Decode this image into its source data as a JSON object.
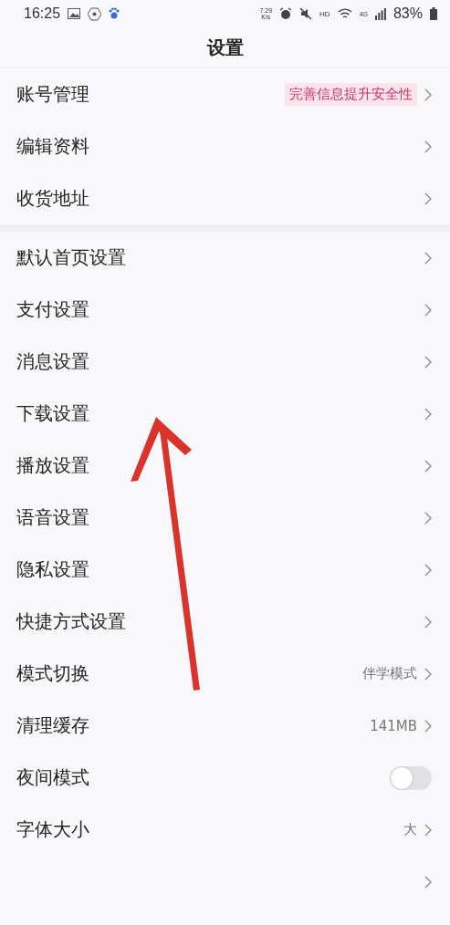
{
  "status_bar": {
    "time": "16:25",
    "net_speed": "7.29",
    "net_speed_unit": "K/s",
    "hd": "HD",
    "network": "4G",
    "battery": "83%"
  },
  "title": "设置",
  "groups": [
    {
      "items": [
        {
          "label": "账号管理",
          "kind": "badge",
          "value": "完善信息提升安全性"
        },
        {
          "label": "编辑资料",
          "kind": "link"
        },
        {
          "label": "收货地址",
          "kind": "link"
        }
      ]
    },
    {
      "items": [
        {
          "label": "默认首页设置",
          "kind": "link"
        },
        {
          "label": "支付设置",
          "kind": "link"
        },
        {
          "label": "消息设置",
          "kind": "link"
        },
        {
          "label": "下载设置",
          "kind": "link"
        },
        {
          "label": "播放设置",
          "kind": "link"
        },
        {
          "label": "语音设置",
          "kind": "link"
        },
        {
          "label": "隐私设置",
          "kind": "link"
        },
        {
          "label": "快捷方式设置",
          "kind": "link"
        },
        {
          "label": "模式切换",
          "kind": "value",
          "value": "伴学模式"
        },
        {
          "label": "清理缓存",
          "kind": "value",
          "value": "141MB"
        },
        {
          "label": "夜间模式",
          "kind": "toggle",
          "on": false
        },
        {
          "label": "字体大小",
          "kind": "value",
          "value": "大"
        },
        {
          "kind": "link"
        }
      ]
    }
  ]
}
